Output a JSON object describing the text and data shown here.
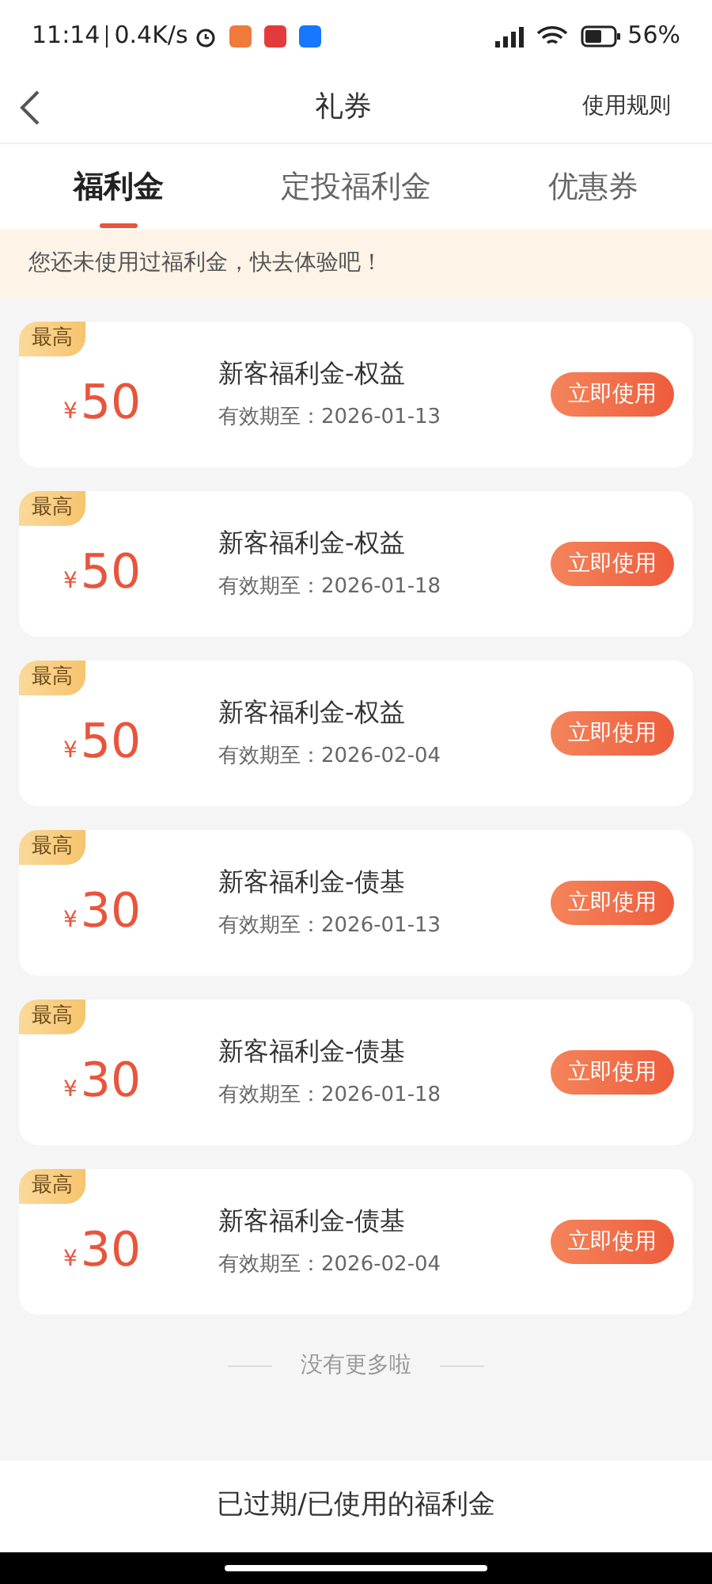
{
  "status_bar": {
    "time": "11:14",
    "speed": "0.4K/s",
    "battery": "56%"
  },
  "header": {
    "title": "礼券",
    "rules_link": "使用规则"
  },
  "tabs": [
    {
      "label": "福利金",
      "selected": true
    },
    {
      "label": "定投福利金",
      "selected": false
    },
    {
      "label": "优惠券",
      "selected": false
    }
  ],
  "notice": "您还未使用过福利金，快去体验吧！",
  "coupons": [
    {
      "badge": "最高",
      "currency": "¥",
      "amount": "50",
      "name": "新客福利金-权益",
      "expiry": "有效期至：2026-01-13",
      "button": "立即使用"
    },
    {
      "badge": "最高",
      "currency": "¥",
      "amount": "50",
      "name": "新客福利金-权益",
      "expiry": "有效期至：2026-01-18",
      "button": "立即使用"
    },
    {
      "badge": "最高",
      "currency": "¥",
      "amount": "50",
      "name": "新客福利金-权益",
      "expiry": "有效期至：2026-02-04",
      "button": "立即使用"
    },
    {
      "badge": "最高",
      "currency": "¥",
      "amount": "30",
      "name": "新客福利金-债基",
      "expiry": "有效期至：2026-01-13",
      "button": "立即使用"
    },
    {
      "badge": "最高",
      "currency": "¥",
      "amount": "30",
      "name": "新客福利金-债基",
      "expiry": "有效期至：2026-01-18",
      "button": "立即使用"
    },
    {
      "badge": "最高",
      "currency": "¥",
      "amount": "30",
      "name": "新客福利金-债基",
      "expiry": "有效期至：2026-02-04",
      "button": "立即使用"
    }
  ],
  "end_note": "没有更多啦",
  "footer_link": "已过期/已使用的福利金"
}
